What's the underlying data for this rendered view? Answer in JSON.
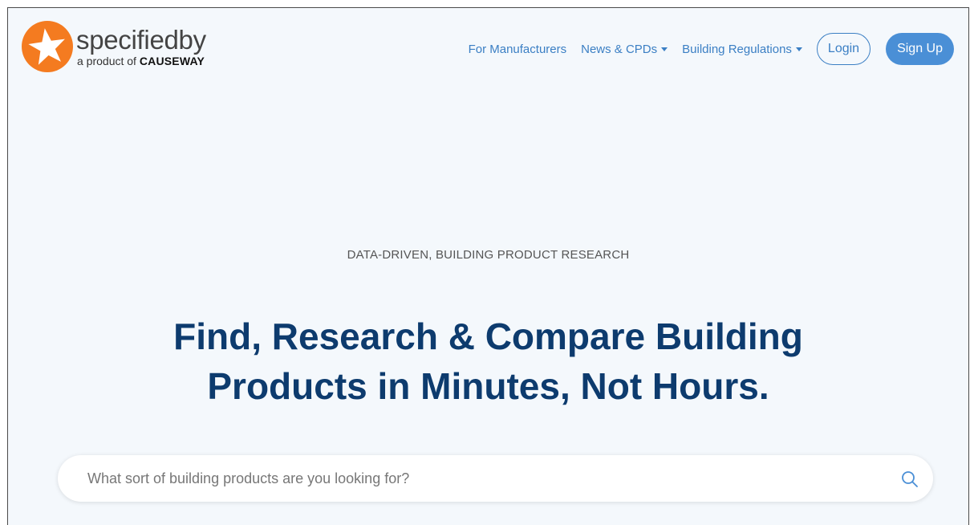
{
  "brand": {
    "name_bold": "specified",
    "name_light": "by",
    "byline_prefix": "a product of",
    "byline_company": "CAUSEWAY",
    "logo_icon": "star-icon",
    "logo_color": "#f47b20"
  },
  "nav": {
    "items": [
      {
        "label": "For Manufacturers",
        "dropdown": false
      },
      {
        "label": "News & CPDs",
        "dropdown": true
      },
      {
        "label": "Building Regulations",
        "dropdown": true
      }
    ],
    "login_label": "Login",
    "signup_label": "Sign Up",
    "accent_color": "#3b7fc4"
  },
  "hero": {
    "eyebrow": "DATA-DRIVEN, BUILDING PRODUCT RESEARCH",
    "headline_line1": "Find, Research & Compare Building",
    "headline_line2": "Products in Minutes, Not Hours.",
    "headline_color": "#0d3b6e"
  },
  "search": {
    "placeholder": "What sort of building products are you looking for?",
    "value": "",
    "icon": "search-icon"
  }
}
